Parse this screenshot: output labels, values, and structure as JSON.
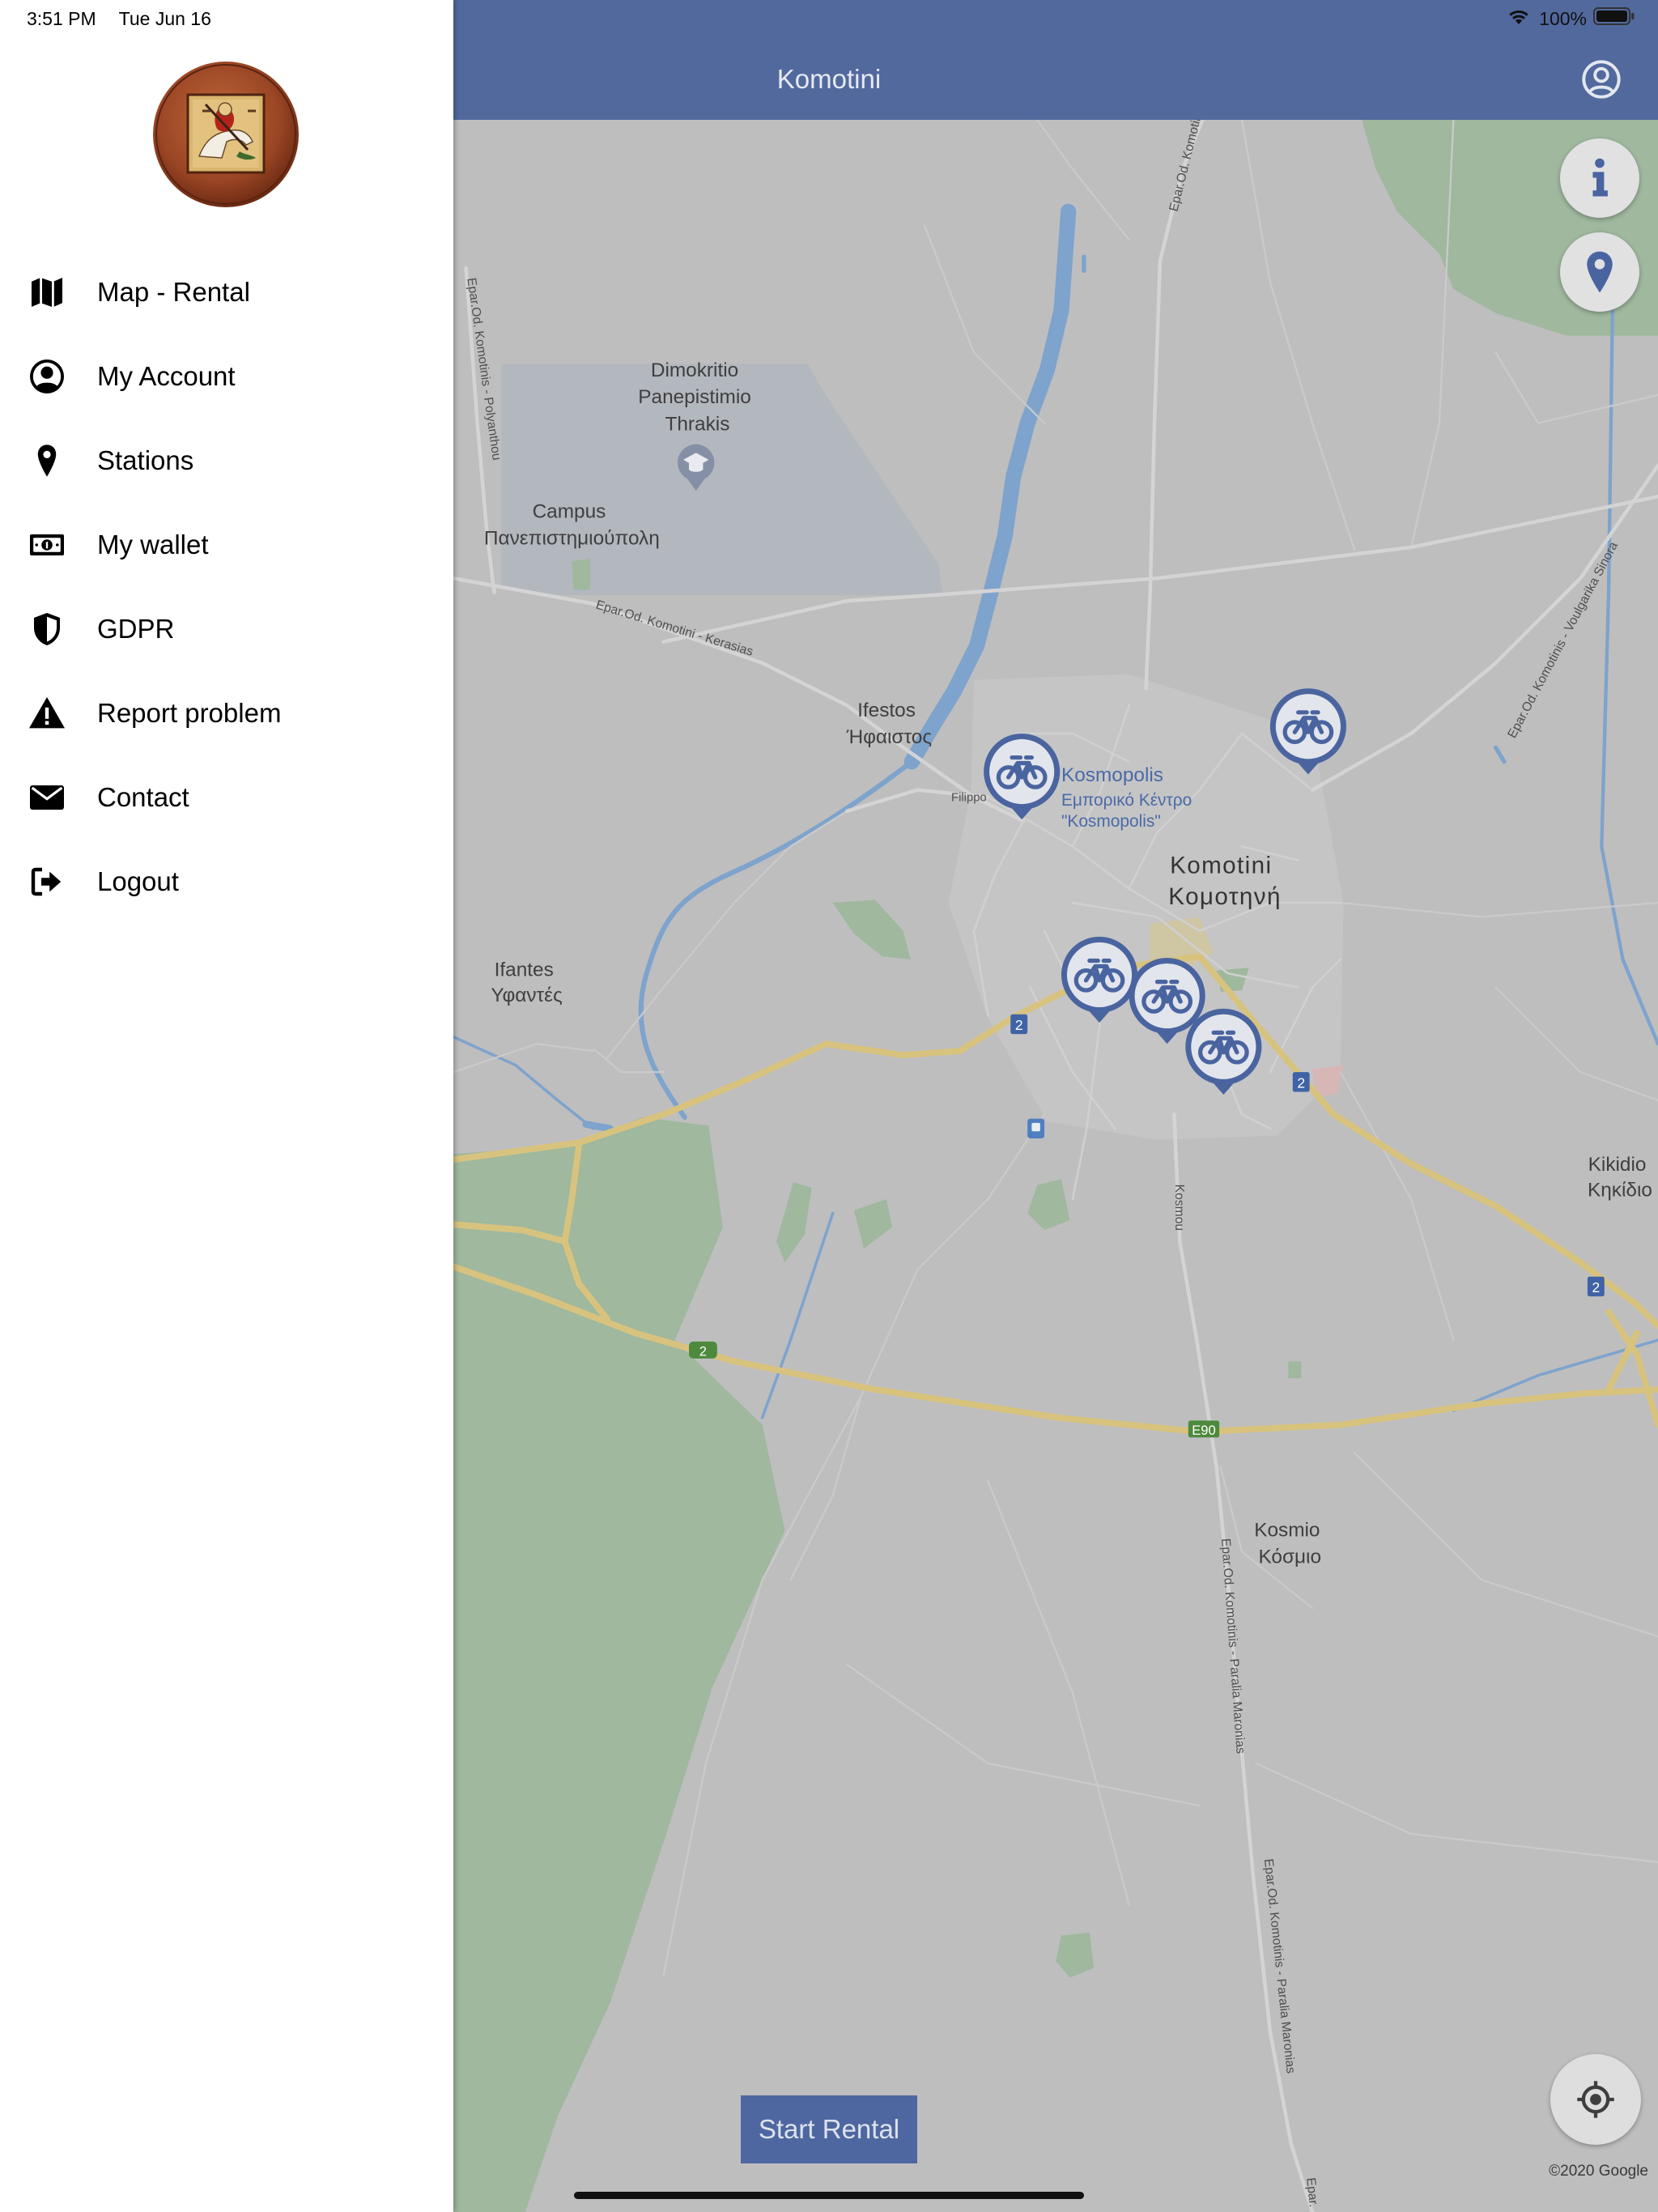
{
  "status_bar": {
    "time": "3:51 PM",
    "date": "Tue Jun 16",
    "battery_percent": "100%",
    "icons": [
      "wifi-icon",
      "battery-icon"
    ]
  },
  "sidebar": {
    "logo_icon": "municipality-logo",
    "items": [
      {
        "label": "Map - Rental",
        "icon": "map-icon"
      },
      {
        "label": "My Account",
        "icon": "account-circle-icon"
      },
      {
        "label": "Stations",
        "icon": "location-pin-icon"
      },
      {
        "label": "My wallet",
        "icon": "banknote-icon"
      },
      {
        "label": "GDPR",
        "icon": "shield-icon"
      },
      {
        "label": "Report problem",
        "icon": "warning-icon"
      },
      {
        "label": "Contact",
        "icon": "envelope-icon"
      },
      {
        "label": "Logout",
        "icon": "logout-icon"
      }
    ]
  },
  "header": {
    "title": "Komotini",
    "account_icon": "account-circle-icon"
  },
  "map": {
    "places": {
      "university": {
        "line1": "Dimokritio",
        "line2": "Panepistimio",
        "line3": "Thrakis",
        "icon": "graduation-cap-icon"
      },
      "campus": {
        "line1": "Campus",
        "line2": "Πανεπιστημιούπολη"
      },
      "ifestos": {
        "line1": "Ifestos",
        "line2": "Ήφαιστος"
      },
      "filippou": "Filippo",
      "kosmopolis": {
        "line1": "Kosmopolis",
        "line2": "Εμπορικό Κέντρο",
        "line3": "\"Kosmopolis\""
      },
      "city": {
        "line1": "Komotini",
        "line2": "Κομοτηνή"
      },
      "ifantes": {
        "line1": "Ifantes",
        "line2": "Υφαντές"
      },
      "kikidio": {
        "line1": "Kikidio",
        "line2": "Κηκίδιο"
      },
      "kosmio": {
        "line1": "Kosmio",
        "line2": "Κόσμιο"
      }
    },
    "roads": {
      "kerasias": "Epar.Od. Komotini - Kerasias",
      "polyanthou": "Epar.Od. Komotinis - Polyanthou",
      "north": "Epar.Od. Komotini",
      "voulgarika": "Epar.Od. Komotinis - Voulgarika Sinora",
      "kosmou": "Kosmou",
      "maronias_1": "Epar.Od. Komotinis - Paralia Maronias",
      "maronias_2": "Epar.Od. Komotinis - Paralia Maronias",
      "south": "Epar."
    },
    "route_shields": [
      "2",
      "2",
      "2",
      "2",
      "E90"
    ],
    "transit_icon": "train-station-icon",
    "station_markers": [
      {
        "icon": "bike-station-marker"
      },
      {
        "icon": "bike-station-marker"
      },
      {
        "icon": "bike-station-marker"
      },
      {
        "icon": "bike-station-marker"
      },
      {
        "icon": "bike-station-marker"
      }
    ],
    "attribution": "©2020 Google"
  },
  "map_controls": {
    "info_icon": "info-icon",
    "stations_icon": "location-pin-icon",
    "locate_icon": "crosshair-icon"
  },
  "actions": {
    "start_rental_label": "Start Rental"
  },
  "colors": {
    "brand": "#52699E",
    "marker_blue": "#4A64A0",
    "button_blue": "#4F67A0",
    "map_background": "#BEBEBF",
    "park_green": "#9FB89E",
    "water_blue": "#7EA3CC",
    "highway_yellow": "#D8C37E",
    "route_shield_blue": "#3F63A6",
    "route_shield_green": "#4E8A3E"
  }
}
